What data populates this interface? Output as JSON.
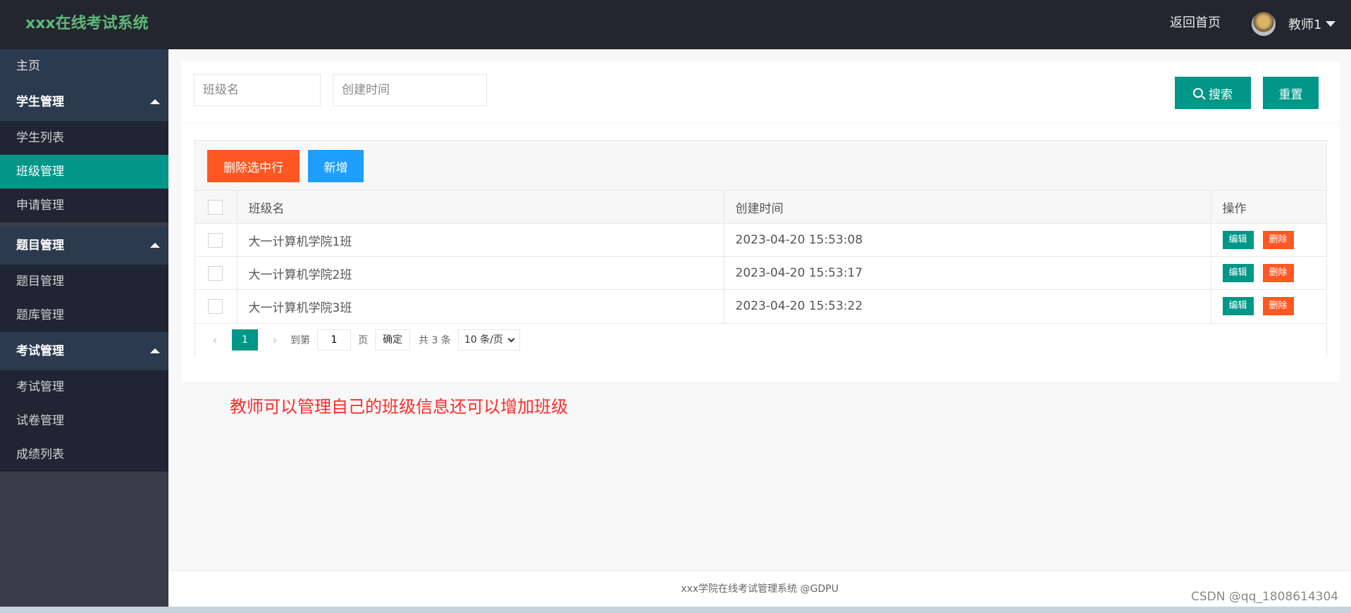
{
  "header": {
    "logo": "xxx在线考试系统",
    "home_link": "返回首页",
    "user_name": "教师1"
  },
  "sidebar": {
    "home": "主页",
    "groups": [
      {
        "label": "学生管理",
        "items": [
          "学生列表",
          "班级管理",
          "申请管理"
        ]
      },
      {
        "label": "题目管理",
        "items": [
          "题目管理",
          "题库管理"
        ]
      },
      {
        "label": "考试管理",
        "items": [
          "考试管理",
          "试卷管理",
          "成绩列表"
        ]
      }
    ],
    "active_item": "班级管理"
  },
  "search": {
    "class_name_placeholder": "班级名",
    "created_time_placeholder": "创建时间",
    "search_label": "搜索",
    "reset_label": "重置"
  },
  "toolbar": {
    "delete_selected_label": "删除选中行",
    "add_label": "新增"
  },
  "table": {
    "columns": [
      "班级名",
      "创建时间",
      "操作"
    ],
    "rows": [
      {
        "name": "大一计算机学院1班",
        "created": "2023-04-20 15:53:08"
      },
      {
        "name": "大一计算机学院2班",
        "created": "2023-04-20 15:53:17"
      },
      {
        "name": "大一计算机学院3班",
        "created": "2023-04-20 15:53:22"
      }
    ],
    "edit_label": "编辑",
    "delete_label": "删除"
  },
  "pagination": {
    "current_page": "1",
    "goto_prefix": "到第",
    "goto_value": "1",
    "goto_suffix": "页",
    "confirm_label": "确定",
    "total_text": "共 3 条",
    "page_size": "10 条/页"
  },
  "note": "教师可以管理自己的班级信息还可以增加班级",
  "footer": "xxx学院在线考试管理系统 @GDPU",
  "watermark": "CSDN @qq_1808614304",
  "colors": {
    "header_bg": "#23262e",
    "logo": "#5fb878",
    "accent": "#009688",
    "danger": "#ff5722",
    "primary": "#1e9fff",
    "note": "#ff2a2a"
  }
}
